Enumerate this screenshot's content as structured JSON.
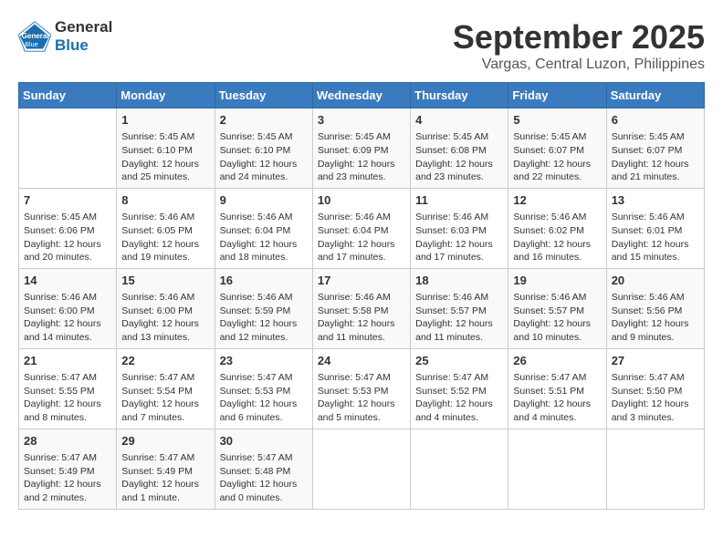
{
  "header": {
    "logo_line1": "General",
    "logo_line2": "Blue",
    "month": "September 2025",
    "location": "Vargas, Central Luzon, Philippines"
  },
  "days_of_week": [
    "Sunday",
    "Monday",
    "Tuesday",
    "Wednesday",
    "Thursday",
    "Friday",
    "Saturday"
  ],
  "weeks": [
    [
      {
        "day": "",
        "sunrise": "",
        "sunset": "",
        "daylight": ""
      },
      {
        "day": "1",
        "sunrise": "Sunrise: 5:45 AM",
        "sunset": "Sunset: 6:10 PM",
        "daylight": "Daylight: 12 hours and 25 minutes."
      },
      {
        "day": "2",
        "sunrise": "Sunrise: 5:45 AM",
        "sunset": "Sunset: 6:10 PM",
        "daylight": "Daylight: 12 hours and 24 minutes."
      },
      {
        "day": "3",
        "sunrise": "Sunrise: 5:45 AM",
        "sunset": "Sunset: 6:09 PM",
        "daylight": "Daylight: 12 hours and 23 minutes."
      },
      {
        "day": "4",
        "sunrise": "Sunrise: 5:45 AM",
        "sunset": "Sunset: 6:08 PM",
        "daylight": "Daylight: 12 hours and 23 minutes."
      },
      {
        "day": "5",
        "sunrise": "Sunrise: 5:45 AM",
        "sunset": "Sunset: 6:07 PM",
        "daylight": "Daylight: 12 hours and 22 minutes."
      },
      {
        "day": "6",
        "sunrise": "Sunrise: 5:45 AM",
        "sunset": "Sunset: 6:07 PM",
        "daylight": "Daylight: 12 hours and 21 minutes."
      }
    ],
    [
      {
        "day": "7",
        "sunrise": "Sunrise: 5:45 AM",
        "sunset": "Sunset: 6:06 PM",
        "daylight": "Daylight: 12 hours and 20 minutes."
      },
      {
        "day": "8",
        "sunrise": "Sunrise: 5:46 AM",
        "sunset": "Sunset: 6:05 PM",
        "daylight": "Daylight: 12 hours and 19 minutes."
      },
      {
        "day": "9",
        "sunrise": "Sunrise: 5:46 AM",
        "sunset": "Sunset: 6:04 PM",
        "daylight": "Daylight: 12 hours and 18 minutes."
      },
      {
        "day": "10",
        "sunrise": "Sunrise: 5:46 AM",
        "sunset": "Sunset: 6:04 PM",
        "daylight": "Daylight: 12 hours and 17 minutes."
      },
      {
        "day": "11",
        "sunrise": "Sunrise: 5:46 AM",
        "sunset": "Sunset: 6:03 PM",
        "daylight": "Daylight: 12 hours and 17 minutes."
      },
      {
        "day": "12",
        "sunrise": "Sunrise: 5:46 AM",
        "sunset": "Sunset: 6:02 PM",
        "daylight": "Daylight: 12 hours and 16 minutes."
      },
      {
        "day": "13",
        "sunrise": "Sunrise: 5:46 AM",
        "sunset": "Sunset: 6:01 PM",
        "daylight": "Daylight: 12 hours and 15 minutes."
      }
    ],
    [
      {
        "day": "14",
        "sunrise": "Sunrise: 5:46 AM",
        "sunset": "Sunset: 6:00 PM",
        "daylight": "Daylight: 12 hours and 14 minutes."
      },
      {
        "day": "15",
        "sunrise": "Sunrise: 5:46 AM",
        "sunset": "Sunset: 6:00 PM",
        "daylight": "Daylight: 12 hours and 13 minutes."
      },
      {
        "day": "16",
        "sunrise": "Sunrise: 5:46 AM",
        "sunset": "Sunset: 5:59 PM",
        "daylight": "Daylight: 12 hours and 12 minutes."
      },
      {
        "day": "17",
        "sunrise": "Sunrise: 5:46 AM",
        "sunset": "Sunset: 5:58 PM",
        "daylight": "Daylight: 12 hours and 11 minutes."
      },
      {
        "day": "18",
        "sunrise": "Sunrise: 5:46 AM",
        "sunset": "Sunset: 5:57 PM",
        "daylight": "Daylight: 12 hours and 11 minutes."
      },
      {
        "day": "19",
        "sunrise": "Sunrise: 5:46 AM",
        "sunset": "Sunset: 5:57 PM",
        "daylight": "Daylight: 12 hours and 10 minutes."
      },
      {
        "day": "20",
        "sunrise": "Sunrise: 5:46 AM",
        "sunset": "Sunset: 5:56 PM",
        "daylight": "Daylight: 12 hours and 9 minutes."
      }
    ],
    [
      {
        "day": "21",
        "sunrise": "Sunrise: 5:47 AM",
        "sunset": "Sunset: 5:55 PM",
        "daylight": "Daylight: 12 hours and 8 minutes."
      },
      {
        "day": "22",
        "sunrise": "Sunrise: 5:47 AM",
        "sunset": "Sunset: 5:54 PM",
        "daylight": "Daylight: 12 hours and 7 minutes."
      },
      {
        "day": "23",
        "sunrise": "Sunrise: 5:47 AM",
        "sunset": "Sunset: 5:53 PM",
        "daylight": "Daylight: 12 hours and 6 minutes."
      },
      {
        "day": "24",
        "sunrise": "Sunrise: 5:47 AM",
        "sunset": "Sunset: 5:53 PM",
        "daylight": "Daylight: 12 hours and 5 minutes."
      },
      {
        "day": "25",
        "sunrise": "Sunrise: 5:47 AM",
        "sunset": "Sunset: 5:52 PM",
        "daylight": "Daylight: 12 hours and 4 minutes."
      },
      {
        "day": "26",
        "sunrise": "Sunrise: 5:47 AM",
        "sunset": "Sunset: 5:51 PM",
        "daylight": "Daylight: 12 hours and 4 minutes."
      },
      {
        "day": "27",
        "sunrise": "Sunrise: 5:47 AM",
        "sunset": "Sunset: 5:50 PM",
        "daylight": "Daylight: 12 hours and 3 minutes."
      }
    ],
    [
      {
        "day": "28",
        "sunrise": "Sunrise: 5:47 AM",
        "sunset": "Sunset: 5:49 PM",
        "daylight": "Daylight: 12 hours and 2 minutes."
      },
      {
        "day": "29",
        "sunrise": "Sunrise: 5:47 AM",
        "sunset": "Sunset: 5:49 PM",
        "daylight": "Daylight: 12 hours and 1 minute."
      },
      {
        "day": "30",
        "sunrise": "Sunrise: 5:47 AM",
        "sunset": "Sunset: 5:48 PM",
        "daylight": "Daylight: 12 hours and 0 minutes."
      },
      {
        "day": "",
        "sunrise": "",
        "sunset": "",
        "daylight": ""
      },
      {
        "day": "",
        "sunrise": "",
        "sunset": "",
        "daylight": ""
      },
      {
        "day": "",
        "sunrise": "",
        "sunset": "",
        "daylight": ""
      },
      {
        "day": "",
        "sunrise": "",
        "sunset": "",
        "daylight": ""
      }
    ]
  ]
}
